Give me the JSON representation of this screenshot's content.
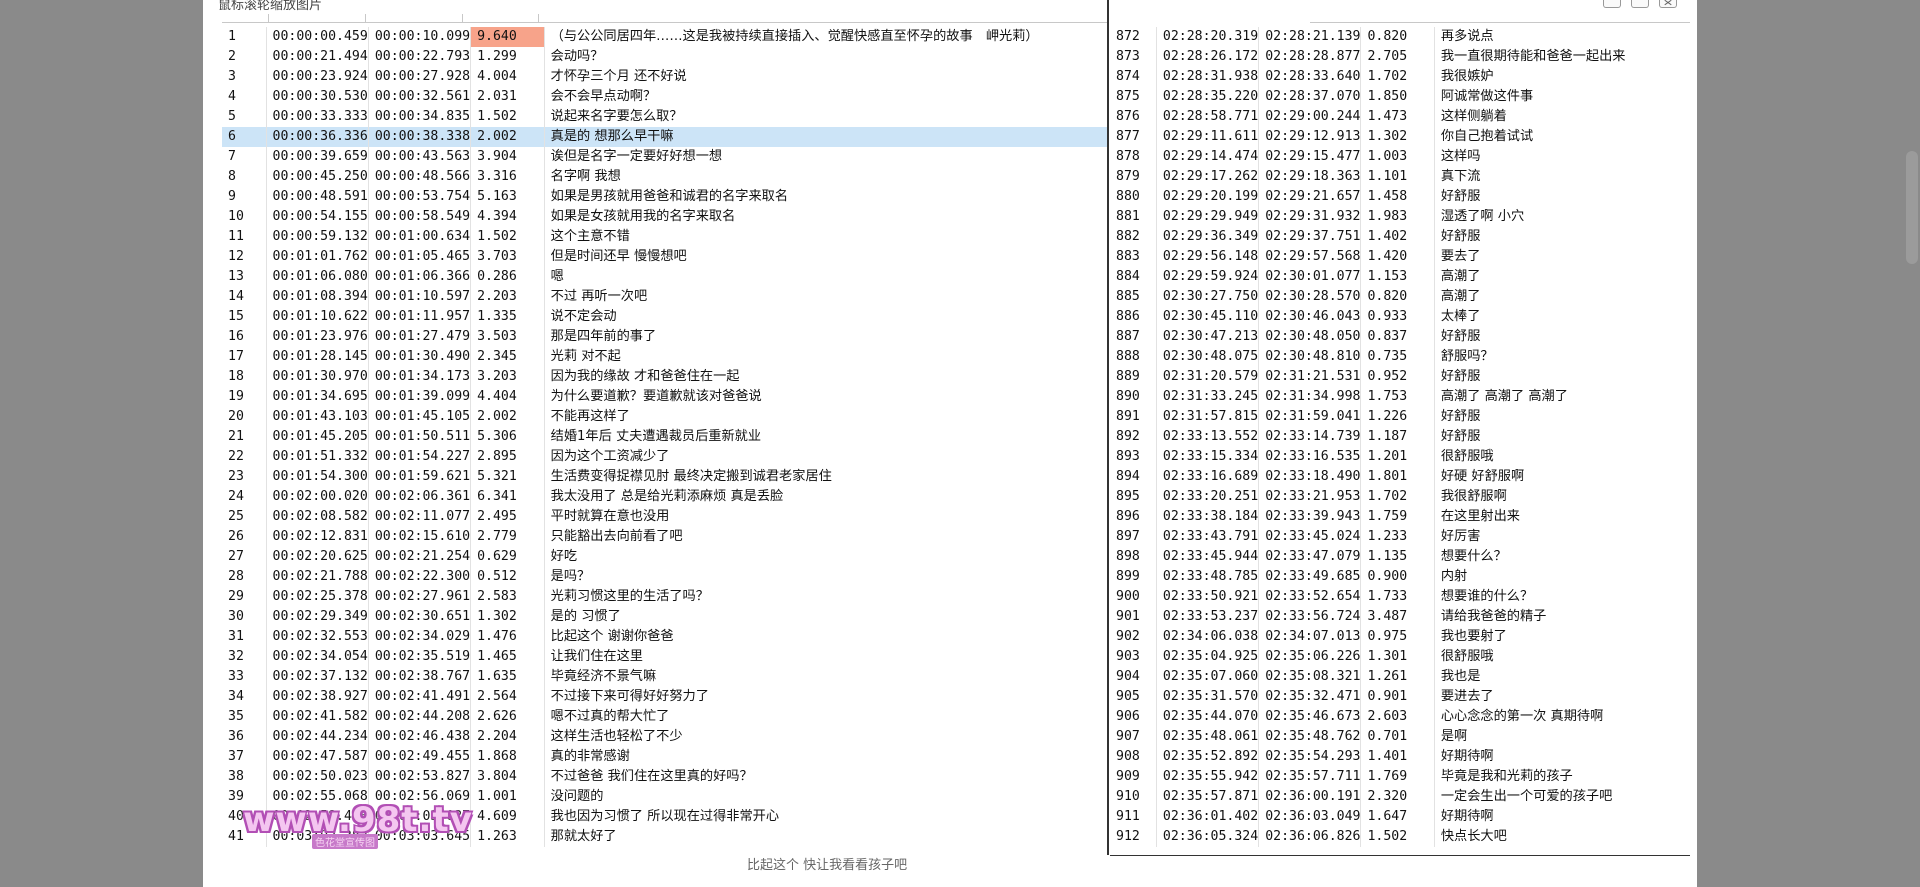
{
  "viewer": {
    "title": "鼠标滚轮缩放图片"
  },
  "columns": [
    {
      "key": "index",
      "width": 46
    },
    {
      "key": "start",
      "width": 97
    },
    {
      "key": "end",
      "width": 97
    },
    {
      "key": "duration",
      "width": 76
    },
    {
      "key": "text",
      "width": 569
    }
  ],
  "right_columns": [
    {
      "key": "index",
      "width": 48
    },
    {
      "key": "start",
      "width": 97
    },
    {
      "key": "end",
      "width": 97
    },
    {
      "key": "duration",
      "width": 76
    },
    {
      "key": "text",
      "width": 262
    }
  ],
  "left_rows": [
    [
      "1",
      "00:00:00.459",
      "00:00:10.099",
      "9.640",
      "（与公公同居四年……这是我被持续直接插入、觉醒快感直至怀孕的故事　岬光莉）"
    ],
    [
      "2",
      "00:00:21.494",
      "00:00:22.793",
      "1.299",
      "会动吗？"
    ],
    [
      "3",
      "00:00:23.924",
      "00:00:27.928",
      "4.004",
      "才怀孕三个月 还不好说"
    ],
    [
      "4",
      "00:00:30.530",
      "00:00:32.561",
      "2.031",
      "会不会早点动啊？"
    ],
    [
      "5",
      "00:00:33.333",
      "00:00:34.835",
      "1.502",
      "说起来名字要怎么取？"
    ],
    [
      "6",
      "00:00:36.336",
      "00:00:38.338",
      "2.002",
      "真是的 想那么早干嘛"
    ],
    [
      "7",
      "00:00:39.659",
      "00:00:43.563",
      "3.904",
      "诶但是名字一定要好好想一想"
    ],
    [
      "8",
      "00:00:45.250",
      "00:00:48.566",
      "3.316",
      "名字啊 我想"
    ],
    [
      "9",
      "00:00:48.591",
      "00:00:53.754",
      "5.163",
      "如果是男孩就用爸爸和诚君的名字来取名"
    ],
    [
      "10",
      "00:00:54.155",
      "00:00:58.549",
      "4.394",
      "如果是女孩就用我的名字来取名"
    ],
    [
      "11",
      "00:00:59.132",
      "00:01:00.634",
      "1.502",
      "这个主意不错"
    ],
    [
      "12",
      "00:01:01.762",
      "00:01:05.465",
      "3.703",
      "但是时间还早 慢慢想吧"
    ],
    [
      "13",
      "00:01:06.080",
      "00:01:06.366",
      "0.286",
      "嗯"
    ],
    [
      "14",
      "00:01:08.394",
      "00:01:10.597",
      "2.203",
      "不过 再听一次吧"
    ],
    [
      "15",
      "00:01:10.622",
      "00:01:11.957",
      "1.335",
      "说不定会动"
    ],
    [
      "16",
      "00:01:23.976",
      "00:01:27.479",
      "3.503",
      "那是四年前的事了"
    ],
    [
      "17",
      "00:01:28.145",
      "00:01:30.490",
      "2.345",
      "光莉 对不起"
    ],
    [
      "18",
      "00:01:30.970",
      "00:01:34.173",
      "3.203",
      "因为我的缘故 才和爸爸住在一起"
    ],
    [
      "19",
      "00:01:34.695",
      "00:01:39.099",
      "4.404",
      "为什么要道歉？要道歉就该对爸爸说"
    ],
    [
      "20",
      "00:01:43.103",
      "00:01:45.105",
      "2.002",
      "不能再这样了"
    ],
    [
      "21",
      "00:01:45.205",
      "00:01:50.511",
      "5.306",
      "结婚1年后 丈夫遭遇裁员后重新就业"
    ],
    [
      "22",
      "00:01:51.332",
      "00:01:54.227",
      "2.895",
      "因为这个工资减少了"
    ],
    [
      "23",
      "00:01:54.300",
      "00:01:59.621",
      "5.321",
      "生活费变得捉襟见肘 最终决定搬到诚君老家居住"
    ],
    [
      "24",
      "00:02:00.020",
      "00:02:06.361",
      "6.341",
      "我太没用了 总是给光莉添麻烦 真是丢脸"
    ],
    [
      "25",
      "00:02:08.582",
      "00:02:11.077",
      "2.495",
      "平时就算在意也没用"
    ],
    [
      "26",
      "00:02:12.831",
      "00:02:15.610",
      "2.779",
      "只能豁出去向前看了吧"
    ],
    [
      "27",
      "00:02:20.625",
      "00:02:21.254",
      "0.629",
      "好吃"
    ],
    [
      "28",
      "00:02:21.788",
      "00:02:22.300",
      "0.512",
      "是吗？"
    ],
    [
      "29",
      "00:02:25.378",
      "00:02:27.961",
      "2.583",
      "光莉习惯这里的生活了吗？"
    ],
    [
      "30",
      "00:02:29.349",
      "00:02:30.651",
      "1.302",
      "是的 习惯了"
    ],
    [
      "31",
      "00:02:32.553",
      "00:02:34.029",
      "1.476",
      "比起这个 谢谢你爸爸"
    ],
    [
      "32",
      "00:02:34.054",
      "00:02:35.519",
      "1.465",
      "让我们住在这里"
    ],
    [
      "33",
      "00:02:37.132",
      "00:02:38.767",
      "1.635",
      "毕竟经济不景气嘛"
    ],
    [
      "34",
      "00:02:38.927",
      "00:02:41.491",
      "2.564",
      "不过接下来可得好好努力了"
    ],
    [
      "35",
      "00:02:41.582",
      "00:02:44.208",
      "2.626",
      "嗯不过真的帮大忙了"
    ],
    [
      "36",
      "00:02:44.234",
      "00:02:46.438",
      "2.204",
      "这样生活也轻松了不少"
    ],
    [
      "37",
      "00:02:47.587",
      "00:02:49.455",
      "1.868",
      "真的非常感谢"
    ],
    [
      "38",
      "00:02:50.023",
      "00:02:53.827",
      "3.804",
      "不过爸爸 我们住在这里真的好吗？"
    ],
    [
      "39",
      "00:02:55.068",
      "00:02:56.069",
      "1.001",
      "没问题的"
    ],
    [
      "40",
      "00:02:58.418",
      "00:03:03.027",
      "4.609",
      "我也因为习惯了 所以现在过得非常开心"
    ],
    [
      "41",
      "00:03:02.382",
      "00:03:03.645",
      "1.263",
      "那就太好了"
    ]
  ],
  "right_rows": [
    [
      "872",
      "02:28:20.319",
      "02:28:21.139",
      "0.820",
      "再多说点"
    ],
    [
      "873",
      "02:28:26.172",
      "02:28:28.877",
      "2.705",
      "我一直很期待能和爸爸一起出来"
    ],
    [
      "874",
      "02:28:31.938",
      "02:28:33.640",
      "1.702",
      "我很嫉妒"
    ],
    [
      "875",
      "02:28:35.220",
      "02:28:37.070",
      "1.850",
      "阿诚常做这件事"
    ],
    [
      "876",
      "02:28:58.771",
      "02:29:00.244",
      "1.473",
      "这样侧躺着"
    ],
    [
      "877",
      "02:29:11.611",
      "02:29:12.913",
      "1.302",
      "你自己抱着试试"
    ],
    [
      "878",
      "02:29:14.474",
      "02:29:15.477",
      "1.003",
      "这样吗"
    ],
    [
      "879",
      "02:29:17.262",
      "02:29:18.363",
      "1.101",
      "真下流"
    ],
    [
      "880",
      "02:29:20.199",
      "02:29:21.657",
      "1.458",
      "好舒服"
    ],
    [
      "881",
      "02:29:29.949",
      "02:29:31.932",
      "1.983",
      "湿透了啊 小穴"
    ],
    [
      "882",
      "02:29:36.349",
      "02:29:37.751",
      "1.402",
      "好舒服"
    ],
    [
      "883",
      "02:29:56.148",
      "02:29:57.568",
      "1.420",
      "要去了"
    ],
    [
      "884",
      "02:29:59.924",
      "02:30:01.077",
      "1.153",
      "高潮了"
    ],
    [
      "885",
      "02:30:27.750",
      "02:30:28.570",
      "0.820",
      "高潮了"
    ],
    [
      "886",
      "02:30:45.110",
      "02:30:46.043",
      "0.933",
      "太棒了"
    ],
    [
      "887",
      "02:30:47.213",
      "02:30:48.050",
      "0.837",
      "好舒服"
    ],
    [
      "888",
      "02:30:48.075",
      "02:30:48.810",
      "0.735",
      "舒服吗？"
    ],
    [
      "889",
      "02:31:20.579",
      "02:31:21.531",
      "0.952",
      "好舒服"
    ],
    [
      "890",
      "02:31:33.245",
      "02:31:34.998",
      "1.753",
      "高潮了 高潮了 高潮了"
    ],
    [
      "891",
      "02:31:57.815",
      "02:31:59.041",
      "1.226",
      "好舒服"
    ],
    [
      "892",
      "02:33:13.552",
      "02:33:14.739",
      "1.187",
      "好舒服"
    ],
    [
      "893",
      "02:33:15.334",
      "02:33:16.535",
      "1.201",
      "很舒服哦"
    ],
    [
      "894",
      "02:33:16.689",
      "02:33:18.490",
      "1.801",
      "好硬 好舒服啊"
    ],
    [
      "895",
      "02:33:20.251",
      "02:33:21.953",
      "1.702",
      "我很舒服啊"
    ],
    [
      "896",
      "02:33:38.184",
      "02:33:39.943",
      "1.759",
      "在这里射出来"
    ],
    [
      "897",
      "02:33:43.791",
      "02:33:45.024",
      "1.233",
      "好厉害"
    ],
    [
      "898",
      "02:33:45.944",
      "02:33:47.079",
      "1.135",
      "想要什么？"
    ],
    [
      "899",
      "02:33:48.785",
      "02:33:49.685",
      "0.900",
      "内射"
    ],
    [
      "900",
      "02:33:50.921",
      "02:33:52.654",
      "1.733",
      "想要谁的什么？"
    ],
    [
      "901",
      "02:33:53.237",
      "02:33:56.724",
      "3.487",
      "请给我爸爸的精子"
    ],
    [
      "902",
      "02:34:06.038",
      "02:34:07.013",
      "0.975",
      "我也要射了"
    ],
    [
      "903",
      "02:35:04.925",
      "02:35:06.226",
      "1.301",
      "很舒服哦"
    ],
    [
      "904",
      "02:35:07.060",
      "02:35:08.321",
      "1.261",
      "我也是"
    ],
    [
      "905",
      "02:35:31.570",
      "02:35:32.471",
      "0.901",
      "要进去了"
    ],
    [
      "906",
      "02:35:44.070",
      "02:35:46.673",
      "2.603",
      "心心念念的第一次 真期待啊"
    ],
    [
      "907",
      "02:35:48.061",
      "02:35:48.762",
      "0.701",
      "是啊"
    ],
    [
      "908",
      "02:35:52.892",
      "02:35:54.293",
      "1.401",
      "好期待啊"
    ],
    [
      "909",
      "02:35:55.942",
      "02:35:57.711",
      "1.769",
      "毕竟是我和光莉的孩子"
    ],
    [
      "910",
      "02:35:57.871",
      "02:36:00.191",
      "2.320",
      "一定会生出一个可爱的孩子吧"
    ],
    [
      "911",
      "02:36:01.402",
      "02:36:03.049",
      "1.647",
      "好期待啊"
    ],
    [
      "912",
      "02:36:05.324",
      "02:36:06.826",
      "1.502",
      "快点长大吧"
    ]
  ],
  "selected_row_index": 5,
  "highlight_cell": {
    "row": 0,
    "col": 3,
    "color": "#f7a38a"
  },
  "partial_bottom_text": "比起这个 快让我看看孩子吧",
  "watermark": {
    "main": "www.98t.tv",
    "sub": "色花堂宣传图"
  },
  "colors": {
    "selection": "#cce4f7",
    "highlight": "#f7a38a",
    "backdrop": "#8a8a8a"
  }
}
